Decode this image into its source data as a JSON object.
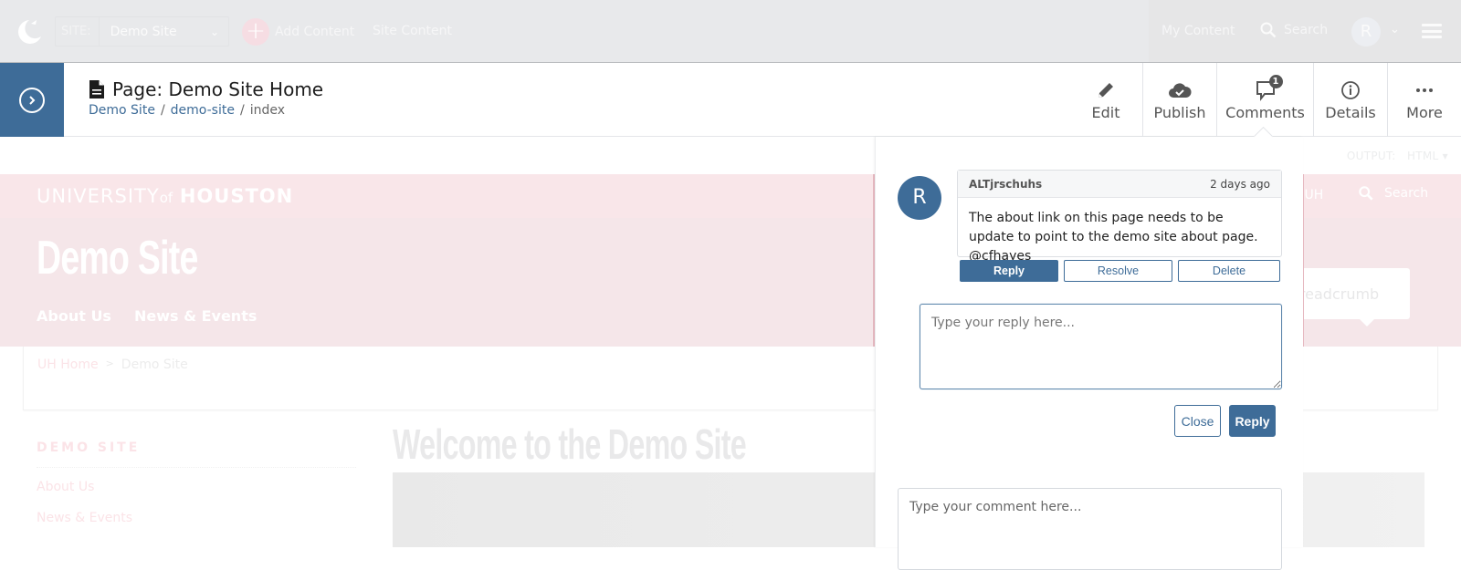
{
  "topnav": {
    "site_label": "SITE:",
    "site_value": "Demo Site",
    "add_content": "Add Content",
    "site_content": "Site Content",
    "my_content": "My Content",
    "search": "Search",
    "avatar_initial": "R"
  },
  "toolbar": {
    "page_title": "Page: Demo Site Home",
    "breadcrumb": [
      {
        "label": "Demo Site",
        "link": true
      },
      {
        "label": "demo-site",
        "link": true
      },
      {
        "label": "index",
        "link": false
      }
    ],
    "separator": "/",
    "actions": [
      {
        "label": "Edit",
        "icon": "pencil-icon"
      },
      {
        "label": "Publish",
        "icon": "cloud-check-icon"
      },
      {
        "label": "Comments",
        "icon": "comment-icon",
        "badge": "1"
      },
      {
        "label": "Details",
        "icon": "info-icon"
      },
      {
        "label": "More",
        "icon": "ellipsis-icon"
      }
    ]
  },
  "site_preview": {
    "output_label": "OUTPUT:",
    "output_value": "HTML",
    "uh_logo": {
      "part1": "UNIVERSITY",
      "part2": "of",
      "part3": "HOUSTON"
    },
    "goto_uh": "to UH",
    "search": "Search",
    "site_name": "Demo Site",
    "nav": [
      "About Us",
      "News & Events"
    ],
    "tooltip": "onBreadcrumb",
    "breadcrumb": {
      "home": "UH Home",
      "separator": ">",
      "current": "Demo Site"
    },
    "sidebar_title": "DEMO SITE",
    "sidebar_links": [
      "About Us",
      "News & Events"
    ],
    "welcome_heading": "Welcome to the Demo Site"
  },
  "comments_panel": {
    "comment": {
      "avatar_initial": "R",
      "author": "ALTjrschuhs",
      "time": "2 days ago",
      "body": "The about link on this page needs to be update to point to the demo site about page. @cfhayes"
    },
    "buttons": {
      "reply": "Reply",
      "resolve": "Resolve",
      "delete": "Delete"
    },
    "reply_placeholder": "Type your reply here...",
    "close_label": "Close",
    "reply_submit_label": "Reply",
    "new_comment_placeholder": "Type your comment here..."
  },
  "colors": {
    "primary": "#3e6c98",
    "topnav_bg": "#e8e9eb",
    "uh_red_dimmed": "#f9e6e9"
  }
}
